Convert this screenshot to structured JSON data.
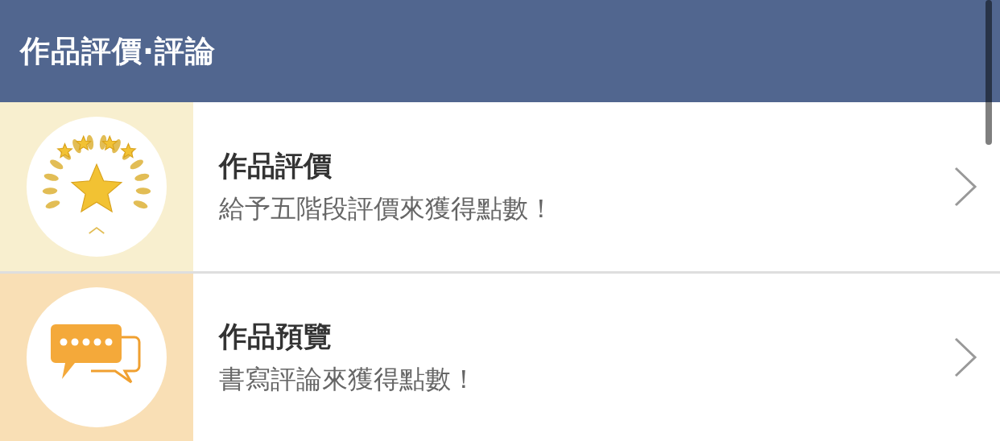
{
  "header": {
    "title": "作品評價·評論"
  },
  "items": [
    {
      "kind": "rating",
      "color": "#f8efcf",
      "title": "作品評價",
      "subtitle": "給予五階段評價來獲得點數！"
    },
    {
      "kind": "review",
      "color": "#f9dfb5",
      "title": "作品預覽",
      "subtitle": "書寫評論來獲得點數！"
    }
  ]
}
